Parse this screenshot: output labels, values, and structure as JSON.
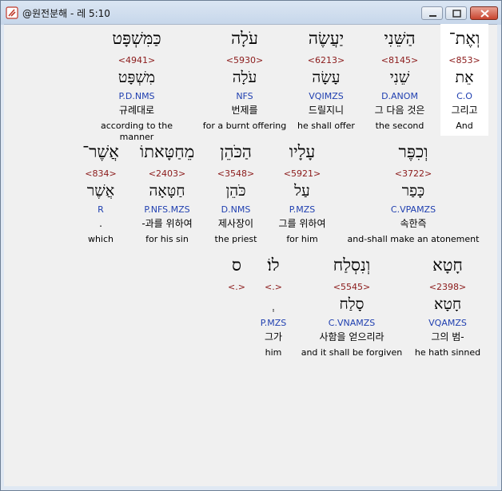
{
  "window": {
    "title": "@원전분해 - 레 5:10"
  },
  "rows": [
    {
      "words": [
        {
          "heb": "וְאֶת־",
          "strong": "<853>",
          "lemma": "אֵת",
          "morph": "C.O",
          "kor": "그리고",
          "eng": "And",
          "highlighted": true
        },
        {
          "heb": "הַשֵּׁנִי",
          "strong": "<8145>",
          "lemma": "שֵׁנִי",
          "morph": "D.ANOM",
          "kor": "그 다음 것은",
          "eng": "the second"
        },
        {
          "heb": "יַעֲשֶׂה",
          "strong": "<6213>",
          "lemma": "עָשָׂה",
          "morph": "VQIMZS",
          "kor": "드릴지니",
          "eng": "he shall offer"
        },
        {
          "heb": "עֹלָה",
          "strong": "<5930>",
          "lemma": "עֹלָה",
          "morph": "NFS",
          "kor": "번제를",
          "eng": "for a burnt offering"
        },
        {
          "heb": "כַּמִּשְׁפָּט",
          "strong": "<4941>",
          "lemma": "מִשְׁפָּט",
          "morph": "P.D.NMS",
          "kor": "규례대로",
          "eng": "according to the manner"
        }
      ]
    },
    {
      "words": [
        {
          "heb": "וְכִפֶּר",
          "strong": "<3722>",
          "lemma": "כָּפַר",
          "morph": "C.VPAMZS",
          "kor": "속한즉",
          "eng": "and-shall make an atonement"
        },
        {
          "heb": "עָלָיו",
          "strong": "<5921>",
          "lemma": "עַל",
          "morph": "P.MZS",
          "kor": "그를 위하여",
          "eng": "for him"
        },
        {
          "heb": "הַכֹּהֵן",
          "strong": "<3548>",
          "lemma": "כֹּהֵן",
          "morph": "D.NMS",
          "kor": "제사장이",
          "eng": "the priest"
        },
        {
          "heb": "מֵחַטָּאתוֹ",
          "strong": "<2403>",
          "lemma": "חַטָּאָה",
          "morph": "P.NFS.MZS",
          "kor": "-과를 위하여",
          "eng": "for his sin"
        },
        {
          "heb": "אֲשֶׁר־",
          "strong": "<834>",
          "lemma": "אֲשֶׁר",
          "morph": "R",
          "kor": ".",
          "eng": "which"
        }
      ]
    },
    {
      "words": [
        {
          "heb": "חָטָא",
          "strong": "<2398>",
          "lemma": "חָטָא",
          "morph": "VQAMZS",
          "kor": "그의 범-",
          "eng": "he hath sinned"
        },
        {
          "heb": "וְנִסְלַח",
          "strong": "<5545>",
          "lemma": "סָלַח",
          "morph": "C.VNAMZS",
          "kor": "사함을 얻으리라",
          "eng": "and it shall be forgiven"
        },
        {
          "heb": "לוֹ׃",
          "strong": "<.>",
          "lemma": "ְ",
          "morph": "P.MZS",
          "kor": "그가",
          "eng": "him"
        },
        {
          "heb": "ס",
          "strong": "<.>",
          "lemma": "",
          "morph": "",
          "kor": "",
          "eng": ""
        }
      ]
    }
  ]
}
